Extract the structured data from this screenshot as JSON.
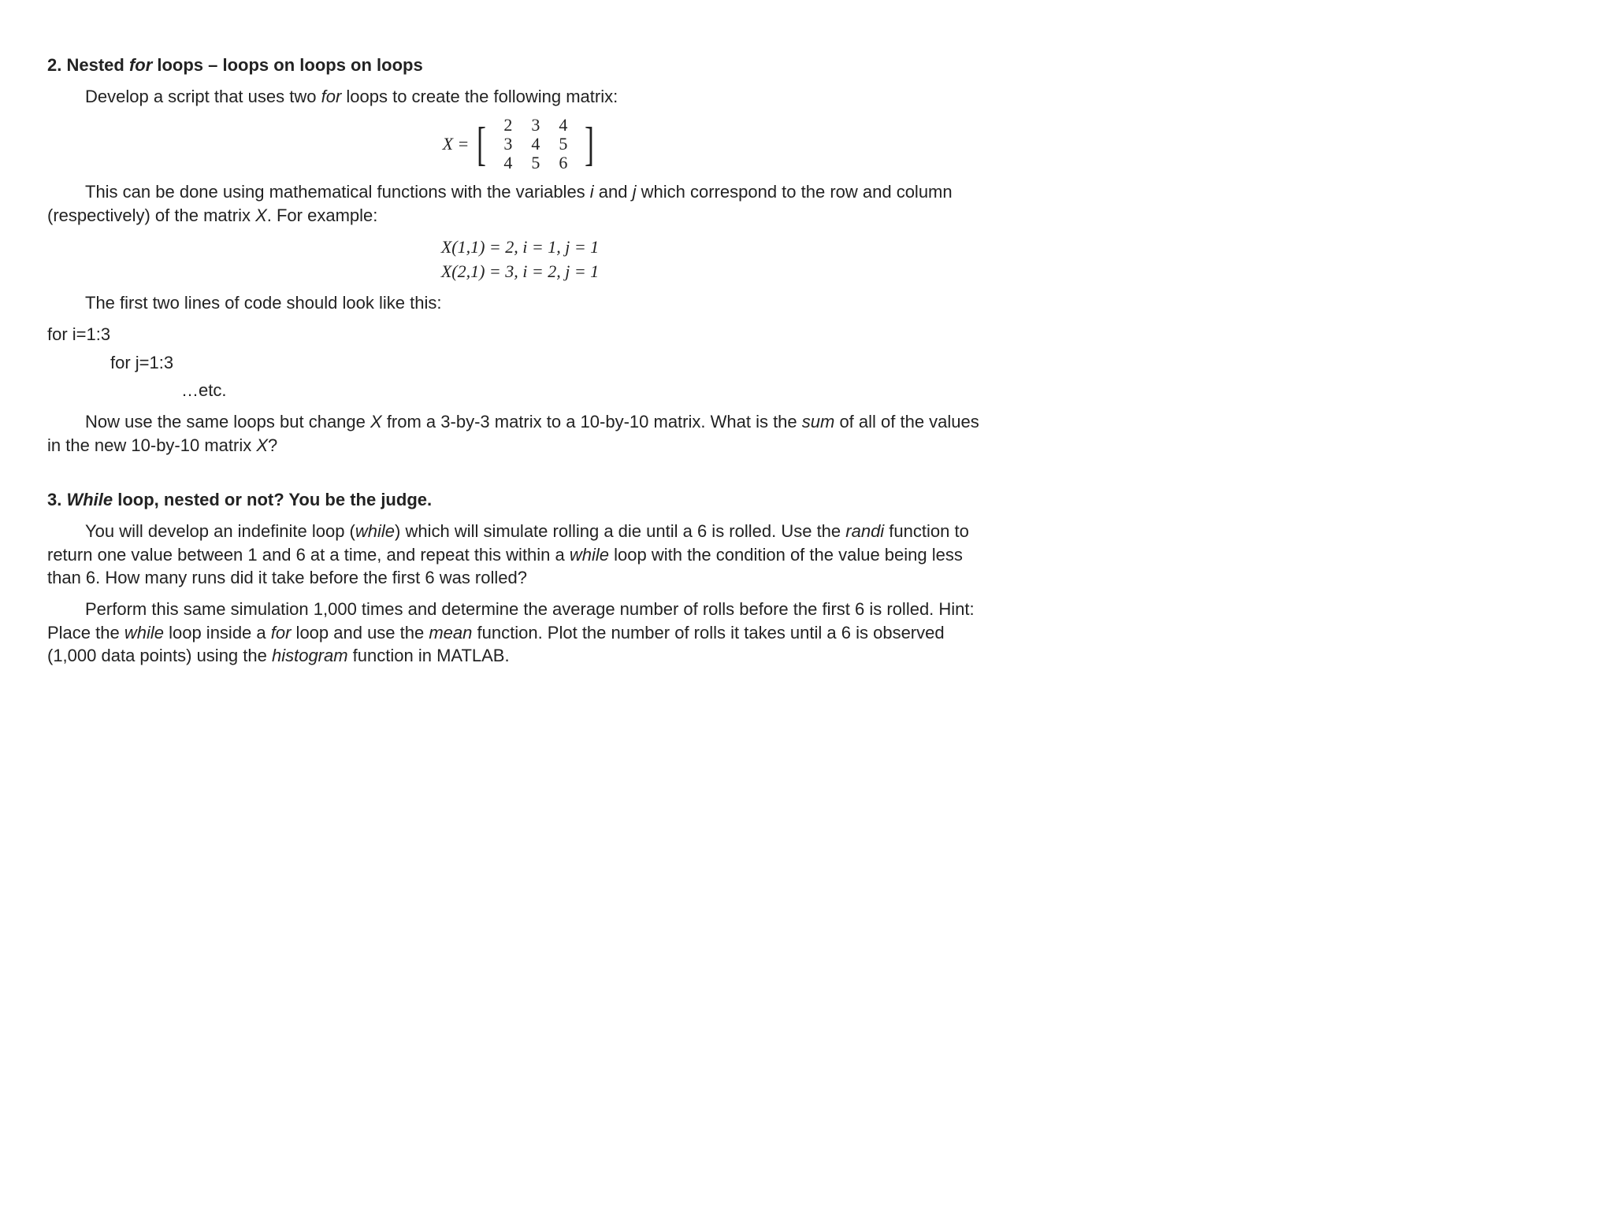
{
  "q2": {
    "title_prefix": "2. Nested ",
    "title_italic": "for",
    "title_suffix": " loops – loops on loops on loops",
    "p1_a": "Develop a script that uses two ",
    "p1_i": "for",
    "p1_b": " loops to create the following matrix:",
    "matrix_lhs": "X =",
    "matrix": {
      "r1c1": "2",
      "r1c2": "3",
      "r1c3": "4",
      "r2c1": "3",
      "r2c2": "4",
      "r2c3": "5",
      "r3c1": "4",
      "r3c2": "5",
      "r3c3": "6"
    },
    "p2_a": "This can be done using mathematical functions with the variables ",
    "p2_i": "i",
    "p2_b": " and ",
    "p2_j": "j",
    "p2_c": " which correspond to the row and column (respectively) of the matrix ",
    "p2_x": "X",
    "p2_d": ". For example:",
    "eq1": "X(1,1) = 2, i = 1, j = 1",
    "eq2": "X(2,1) = 3, i = 2, j = 1",
    "p3": "The first two lines of code should look like this:",
    "code1": "for i=1:3",
    "code2": "for j=1:3",
    "code3": "…etc.",
    "p4_a": "Now use the same loops but change ",
    "p4_x": "X",
    "p4_b": " from a 3-by-3 matrix to a 10-by-10 matrix. What is the ",
    "p4_sum": "sum",
    "p4_c": " of all of the values in the new 10-by-10 matrix ",
    "p4_x2": "X",
    "p4_d": "?"
  },
  "q3": {
    "title_prefix": "3. ",
    "title_italic": "While",
    "title_suffix": " loop, nested or not? You be the judge.",
    "p1_a": "You will develop an indefinite loop (",
    "p1_while": "while",
    "p1_b": ") which will simulate rolling a die until a 6 is rolled. Use the ",
    "p1_randi": "randi",
    "p1_c": " function to return one value between 1 and 6 at a time, and repeat this within a ",
    "p1_while2": "while",
    "p1_d": " loop with the condition of the value being less than 6. How many runs did it take before the first 6 was rolled?",
    "p2_a": "Perform this same simulation 1,000 times and determine the average number of rolls before the first 6 is rolled. Hint: Place the ",
    "p2_while": "while",
    "p2_b": " loop inside a ",
    "p2_for": "for",
    "p2_c": " loop and use the ",
    "p2_mean": "mean",
    "p2_d": " function. Plot the number of rolls it takes until a 6 is observed (1,000 data points) using the ",
    "p2_hist": "histogram",
    "p2_e": " function in MATLAB."
  }
}
